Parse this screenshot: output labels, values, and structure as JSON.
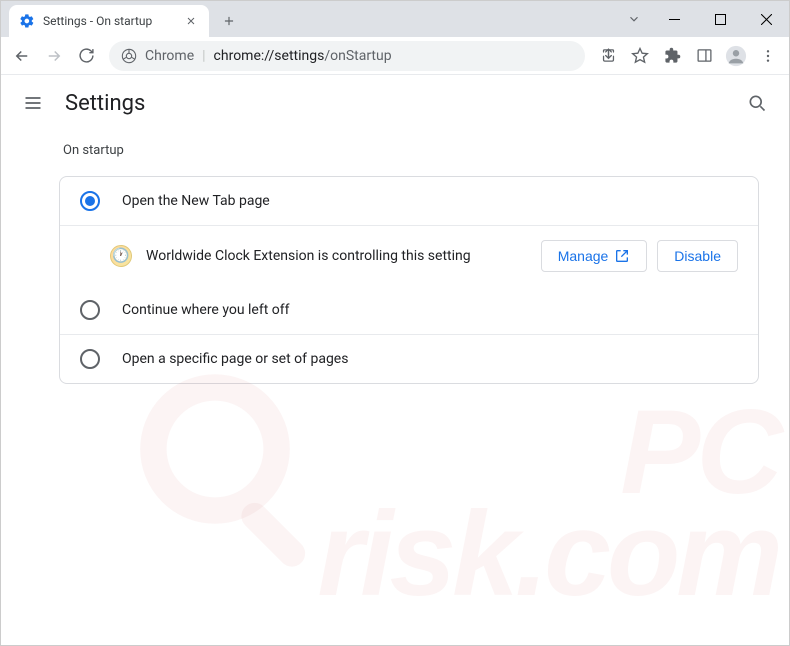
{
  "window": {
    "tab_title": "Settings - On startup"
  },
  "address": {
    "scheme": "Chrome",
    "url_host": "chrome://settings",
    "url_path": "/onStartup"
  },
  "page": {
    "title": "Settings",
    "section": "On startup"
  },
  "options": {
    "opt1": "Open the New Tab page",
    "opt2": "Continue where you left off",
    "opt3": "Open a specific page or set of pages"
  },
  "controlled": {
    "message": "Worldwide Clock Extension is controlling this setting",
    "manage_label": "Manage",
    "disable_label": "Disable"
  },
  "watermark": {
    "line1": "PC",
    "line2": "risk.com"
  }
}
